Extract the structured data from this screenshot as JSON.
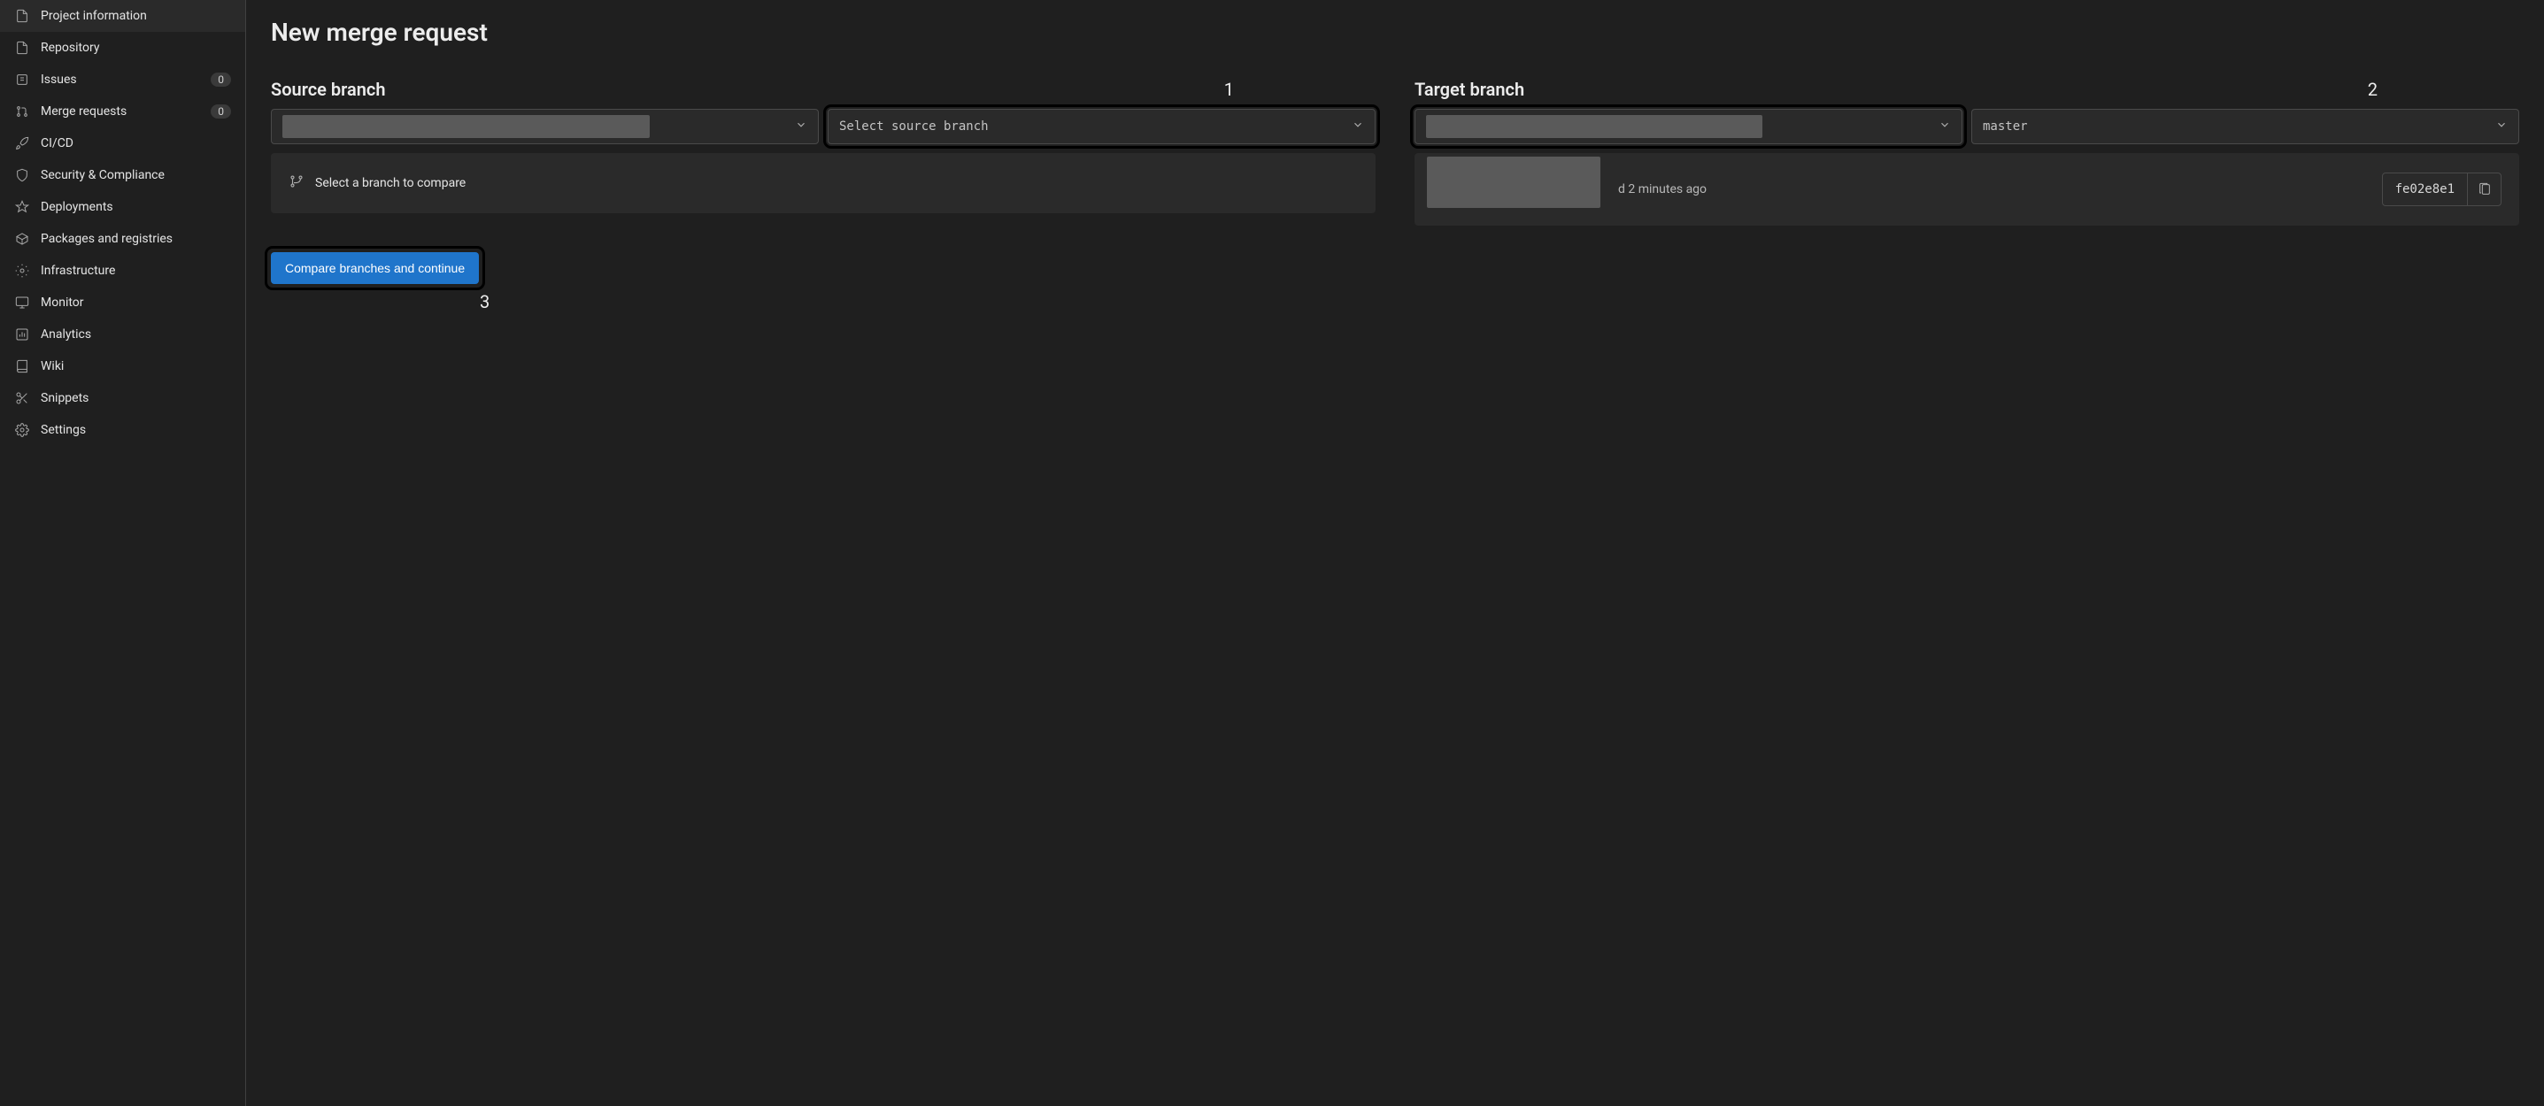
{
  "sidebar": {
    "items": [
      {
        "label": "Project information",
        "icon": "info"
      },
      {
        "label": "Repository",
        "icon": "repo"
      },
      {
        "label": "Issues",
        "icon": "issues",
        "badge": "0"
      },
      {
        "label": "Merge requests",
        "icon": "merge",
        "badge": "0"
      },
      {
        "label": "CI/CD",
        "icon": "cicd"
      },
      {
        "label": "Security & Compliance",
        "icon": "shield"
      },
      {
        "label": "Deployments",
        "icon": "deploy"
      },
      {
        "label": "Packages and registries",
        "icon": "package"
      },
      {
        "label": "Infrastructure",
        "icon": "infra"
      },
      {
        "label": "Monitor",
        "icon": "monitor"
      },
      {
        "label": "Analytics",
        "icon": "analytics"
      },
      {
        "label": "Wiki",
        "icon": "wiki"
      },
      {
        "label": "Snippets",
        "icon": "snippets"
      },
      {
        "label": "Settings",
        "icon": "settings"
      }
    ]
  },
  "page": {
    "title": "New merge request"
  },
  "source": {
    "heading": "Source branch",
    "annotation": "1",
    "branch_select_placeholder": "Select source branch",
    "compare_hint": "Select a branch to compare"
  },
  "target": {
    "heading": "Target branch",
    "annotation": "2",
    "branch_value": "master",
    "commit_time_suffix": "2 minutes ago",
    "commit_time_prefix_fragment": "d",
    "commit_hash": "fe02e8e1"
  },
  "actions": {
    "compare_button": "Compare branches and continue",
    "annotation_3": "3"
  }
}
